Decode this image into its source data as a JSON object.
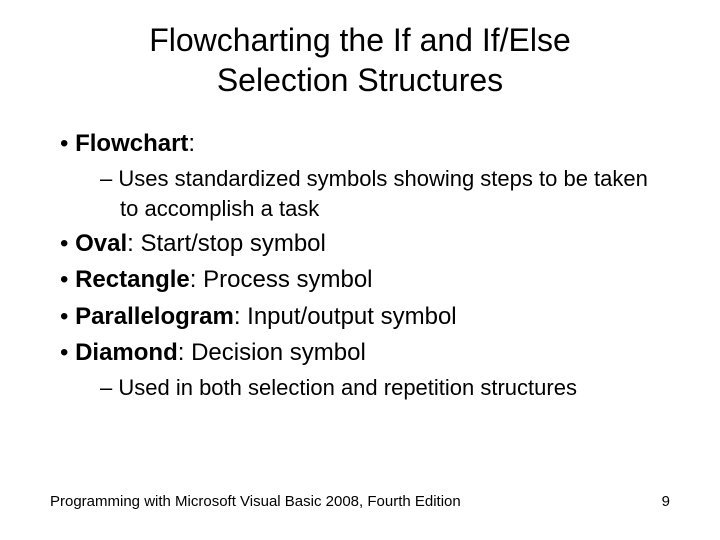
{
  "title": "Flowcharting the If and If/Else Selection Structures",
  "bullets": {
    "flowchart_label": "Flowchart",
    "flowchart_colon": ":",
    "flowchart_sub": "Uses standardized symbols showing steps to be taken to accomplish a task",
    "oval_label": "Oval",
    "oval_rest": ": Start/stop symbol",
    "rectangle_label": "Rectangle",
    "rectangle_rest": ": Process symbol",
    "parallelogram_label": "Parallelogram",
    "parallelogram_rest": ": Input/output symbol",
    "diamond_label": "Diamond",
    "diamond_rest": ": Decision symbol",
    "diamond_sub": "Used in both selection and repetition structures"
  },
  "footer": {
    "book": "Programming with Microsoft Visual Basic 2008, Fourth Edition",
    "page": "9"
  }
}
